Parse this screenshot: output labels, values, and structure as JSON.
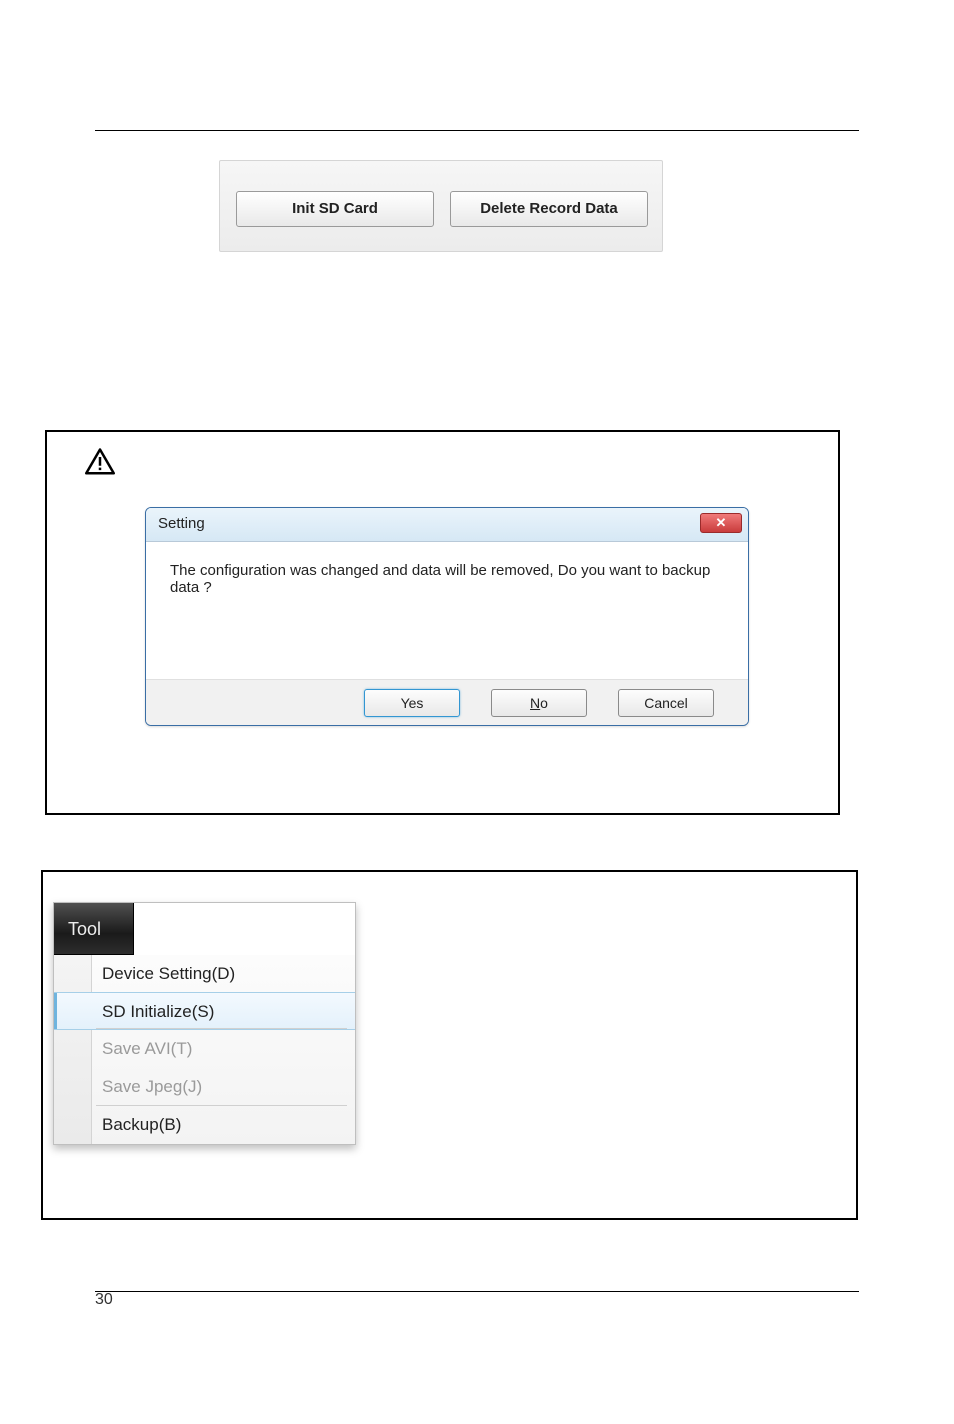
{
  "hr_top": true,
  "page_number": "30",
  "top_panel": {
    "init_btn": "Init SD Card",
    "delete_btn": "Delete Record Data"
  },
  "caution_box": {
    "dialog": {
      "title": "Setting",
      "close_glyph": "✕",
      "message": "The configuration was changed and data will be removed, Do you want to backup data ?",
      "yes": "Yes",
      "no_pre": "N",
      "no_rest": "o",
      "cancel": "Cancel"
    }
  },
  "tool_menu": {
    "tab": "Tool",
    "items": [
      {
        "label": "Device Setting(D)",
        "enabled": true
      },
      {
        "label": "SD Initialize(S)",
        "enabled": true,
        "highlight": true,
        "sep_after": true
      },
      {
        "label": "Save AVI(T)",
        "enabled": false
      },
      {
        "label": "Save Jpeg(J)",
        "enabled": false,
        "sep_after": true
      },
      {
        "label": "Backup(B)",
        "enabled": true
      }
    ]
  }
}
